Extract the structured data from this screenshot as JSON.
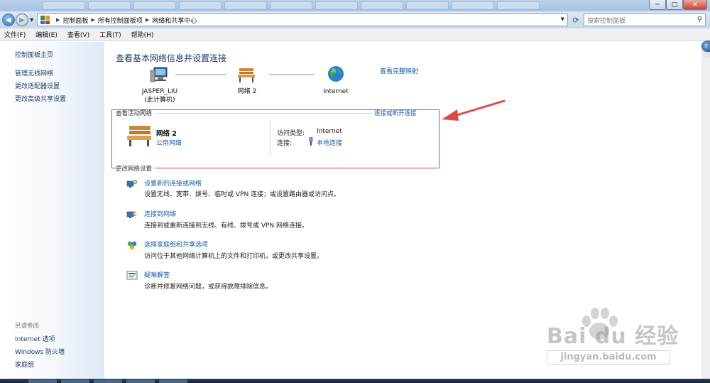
{
  "window": {
    "controls": {
      "minimize": "─",
      "maximize": "□",
      "close": "✕"
    }
  },
  "address_bar": {
    "breadcrumbs": [
      "控制面板",
      "所有控制面板项",
      "网络和共享中心"
    ],
    "search_placeholder": "搜索控制面板"
  },
  "menu": [
    "文件(F)",
    "编辑(E)",
    "查看(V)",
    "工具(T)",
    "帮助(H)"
  ],
  "sidebar": {
    "home": "控制面板主页",
    "items": [
      "管理无线网络",
      "更改适配器设置",
      "更改高级共享设置"
    ],
    "see_also_label": "另请参阅",
    "see_also": [
      "Internet 选项",
      "Windows 防火墙",
      "家庭组"
    ]
  },
  "main": {
    "title": "查看基本网络信息并设置连接",
    "full_map_link": "查看完整映射",
    "map": {
      "computer_name": "JASPER_LIU",
      "computer_sub": "(此计算机)",
      "network_name": "网络  2",
      "internet": "Internet"
    },
    "active": {
      "heading": "查看活动网络",
      "connect_link": "连接或断开连接",
      "network_name": "网络  2",
      "network_type": "公用网络",
      "access_type_label": "访问类型:",
      "access_type_value": "Internet",
      "connections_label": "连接:",
      "connections_value": "本地连接"
    },
    "change": {
      "heading": "更改网络设置",
      "tasks": [
        {
          "title": "设置新的连接或网络",
          "desc": "设置无线、宽带、拨号、临时或 VPN 连接；或设置路由器或访问点。",
          "icon": "new-connection-icon"
        },
        {
          "title": "连接到网络",
          "desc": "连接到或重新连接到无线、有线、拨号或 VPN 网络连接。",
          "icon": "connect-network-icon"
        },
        {
          "title": "选择家庭组和共享选项",
          "desc": "访问位于其他网络计算机上的文件和打印机，或更改共享设置。",
          "icon": "homegroup-icon"
        },
        {
          "title": "疑难解答",
          "desc": "诊断并修复网络问题，或获得故障排除信息。",
          "icon": "troubleshoot-icon"
        }
      ]
    }
  },
  "watermark": {
    "brand": "Bai du 经验",
    "url": "jingyan.baidu.com"
  },
  "colors": {
    "link": "#1c5aa6",
    "title": "#1e3a6a",
    "highlight_box": "#cc4a4a",
    "arrow": "#e04848"
  }
}
